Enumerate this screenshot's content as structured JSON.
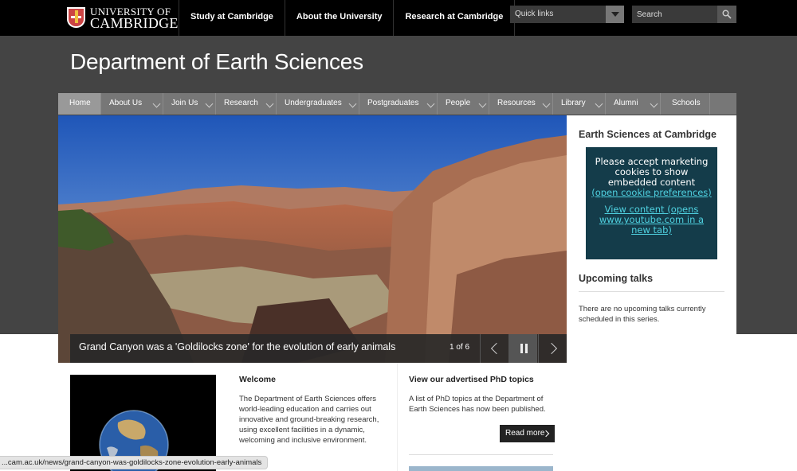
{
  "header": {
    "logo_line1": "UNIVERSITY OF",
    "logo_line2": "CAMBRIDGE",
    "top_nav": [
      "Study at Cambridge",
      "About the University",
      "Research at Cambridge"
    ],
    "quick_links_label": "Quick links",
    "search_placeholder": "Search"
  },
  "department_title": "Department of Earth Sciences",
  "main_nav": [
    {
      "label": "Home",
      "active": true,
      "dropdown": false
    },
    {
      "label": "About Us",
      "dropdown": true
    },
    {
      "label": "Join Us",
      "dropdown": true
    },
    {
      "label": "Research",
      "dropdown": true
    },
    {
      "label": "Undergraduates",
      "dropdown": true
    },
    {
      "label": "Postgraduates",
      "dropdown": true
    },
    {
      "label": "People",
      "dropdown": true
    },
    {
      "label": "Resources",
      "dropdown": true
    },
    {
      "label": "Library",
      "dropdown": true
    },
    {
      "label": "Alumni",
      "dropdown": true
    },
    {
      "label": "Schools",
      "dropdown": false
    }
  ],
  "carousel": {
    "caption": "Grand Canyon was a 'Goldilocks zone' for the evolution of early animals",
    "counter": "1 of 6"
  },
  "sidebar": {
    "section1_title": "Earth Sciences at Cambridge",
    "cookie_message": "Please accept marketing cookies to show embedded content",
    "cookie_link": "(open cookie preferences)",
    "view_link": "View content (opens www.youtube.com in a new tab)",
    "section2_title": "Upcoming talks",
    "no_talks": "There are no upcoming talks currently scheduled in this series."
  },
  "welcome": {
    "title": "Welcome",
    "body": "The Department of Earth Sciences offers world-leading education and carries out innovative and ground-breaking research, using excellent facilities in a dynamic, welcoming and inclusive environment."
  },
  "phd": {
    "title": "View our advertised PhD topics",
    "body": "A list of PhD topics at the Department of Earth Sciences has now been published.",
    "button": "Read more"
  },
  "status_url": "...cam.ac.uk/news/grand-canyon-was-goldilocks-zone-evolution-early-animals",
  "colors": {
    "band": "#444444",
    "nav": "#777777",
    "cookie_bg": "#143c4a",
    "cookie_link": "#4fd1e0"
  }
}
